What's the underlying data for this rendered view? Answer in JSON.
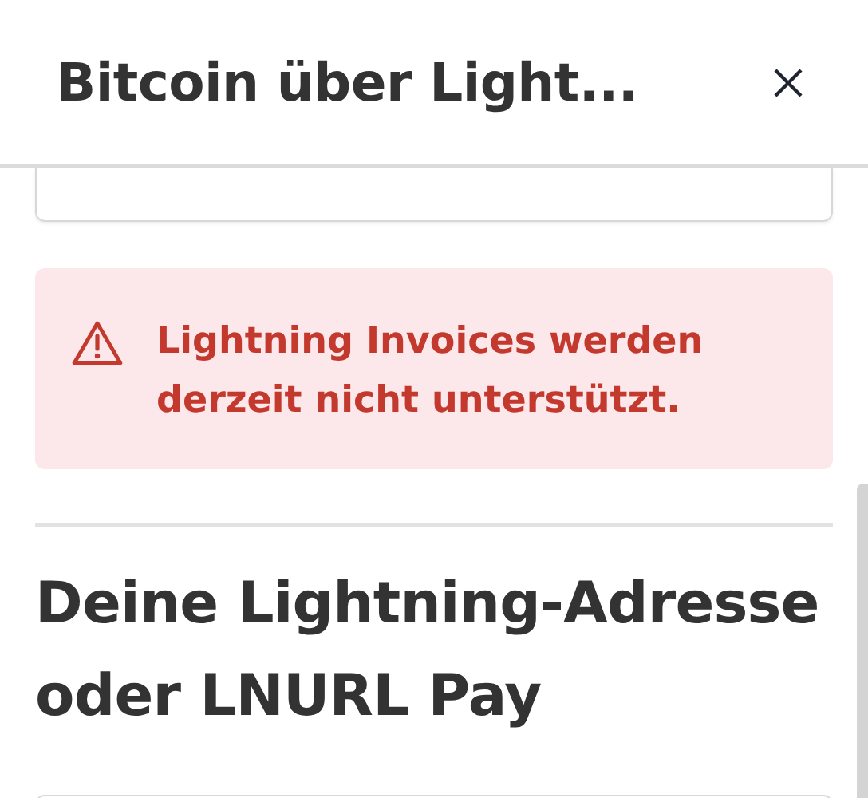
{
  "dialog": {
    "title": "Bitcoin über Light..."
  },
  "alert": {
    "kind": "error",
    "message": "Lightning Invoices werden derzeit nicht unterstützt."
  },
  "section": {
    "heading": "Deine Lightning-Adresse oder LNURL Pay"
  }
}
